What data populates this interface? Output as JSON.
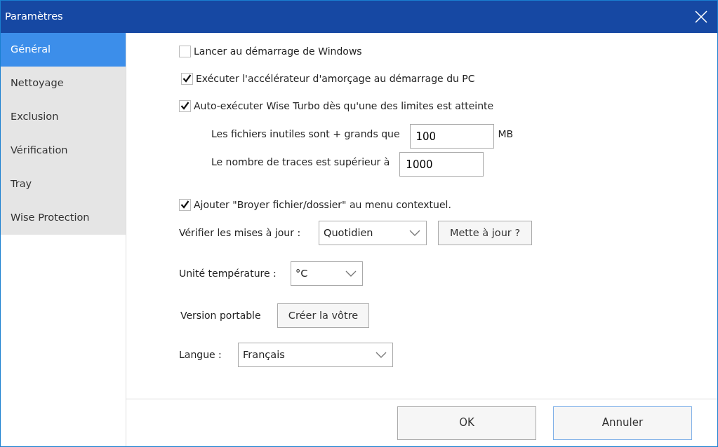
{
  "window": {
    "title": "Paramètres"
  },
  "sidebar": {
    "items": [
      {
        "label": "Général",
        "selected": true
      },
      {
        "label": "Nettoyage",
        "selected": false
      },
      {
        "label": "Exclusion",
        "selected": false
      },
      {
        "label": "Vérification",
        "selected": false
      },
      {
        "label": "Tray",
        "selected": false
      },
      {
        "label": "Wise Protection",
        "selected": false
      }
    ]
  },
  "options": [
    {
      "kind": "checkbox",
      "label": "Lancer au démarrage de Windows",
      "checked": false
    },
    {
      "kind": "checkbox",
      "label": "Exécuter l'accélérateur d'amorçage au démarrage du PC",
      "checked": true
    },
    {
      "kind": "checkbox",
      "label": "Auto-exécuter Wise Turbo dès qu'une des limites est atteinte",
      "checked": true
    },
    {
      "kind": "threshold",
      "label": "Les fichiers inutiles sont + grands que",
      "value": "100",
      "unit": "MB"
    },
    {
      "kind": "threshold",
      "label": "Le nombre de traces est supérieur à",
      "value": "1000"
    },
    {
      "kind": "checkbox",
      "label": "Ajouter \"Broyer fichier/dossier\" au menu contextuel.",
      "checked": true
    }
  ],
  "update_check": {
    "label": "Vérifier les mises à jour :",
    "select": "Quotidien",
    "button": "Mette à jour ?"
  },
  "temperature": {
    "label": "Unité température :",
    "select": "°C"
  },
  "portable": {
    "label": "Version portable",
    "button": "Créer la vôtre"
  },
  "language": {
    "label": "Langue :",
    "select": "Français"
  },
  "footer": {
    "buttons": [
      {
        "label": "OK",
        "focused": false
      },
      {
        "label": "Annuler",
        "focused": true
      }
    ]
  }
}
